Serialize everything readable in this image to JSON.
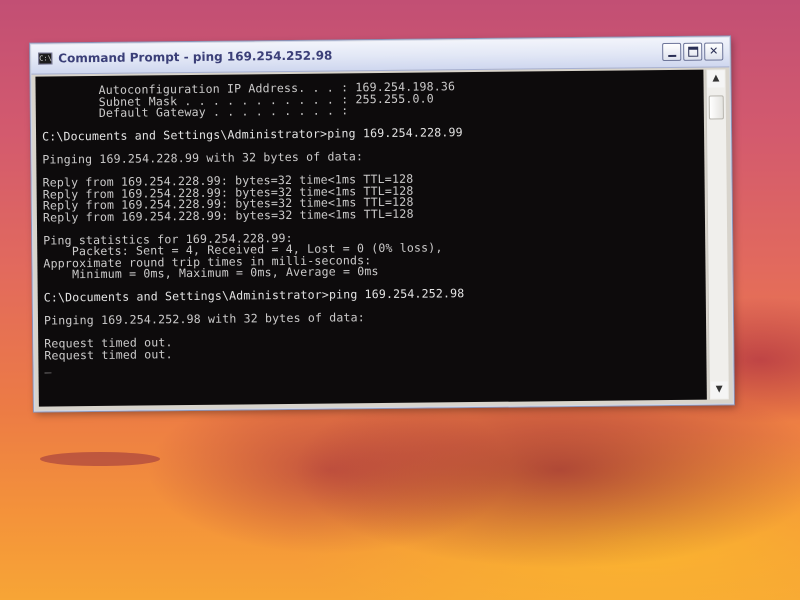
{
  "window": {
    "title": "Command Prompt - ping 169.254.252.98",
    "icon_label": "C:\\",
    "icon": "console-icon",
    "controls": {
      "minimize": "minimize-icon",
      "maximize": "maximize-icon",
      "close_label": "✕"
    }
  },
  "console": {
    "lines": [
      "        Autoconfiguration IP Address. . . : 169.254.198.36",
      "        Subnet Mask . . . . . . . . . . . : 255.255.0.0",
      "        Default Gateway . . . . . . . . . :",
      "",
      "C:\\Documents and Settings\\Administrator>ping 169.254.228.99",
      "",
      "Pinging 169.254.228.99 with 32 bytes of data:",
      "",
      "Reply from 169.254.228.99: bytes=32 time<1ms TTL=128",
      "Reply from 169.254.228.99: bytes=32 time<1ms TTL=128",
      "Reply from 169.254.228.99: bytes=32 time<1ms TTL=128",
      "Reply from 169.254.228.99: bytes=32 time<1ms TTL=128",
      "",
      "Ping statistics for 169.254.228.99:",
      "    Packets: Sent = 4, Received = 4, Lost = 0 (0% loss),",
      "Approximate round trip times in milli-seconds:",
      "    Minimum = 0ms, Maximum = 0ms, Average = 0ms",
      "",
      "C:\\Documents and Settings\\Administrator>ping 169.254.252.98",
      "",
      "Pinging 169.254.252.98 with 32 bytes of data:",
      "",
      "Request timed out.",
      "Request timed out.",
      "_"
    ],
    "colors": {
      "background": "#0d0b0c",
      "text": "#cbcaca"
    }
  },
  "scrollbar": {
    "up_arrow": "▲",
    "down_arrow": "▼",
    "position": 0.03
  }
}
